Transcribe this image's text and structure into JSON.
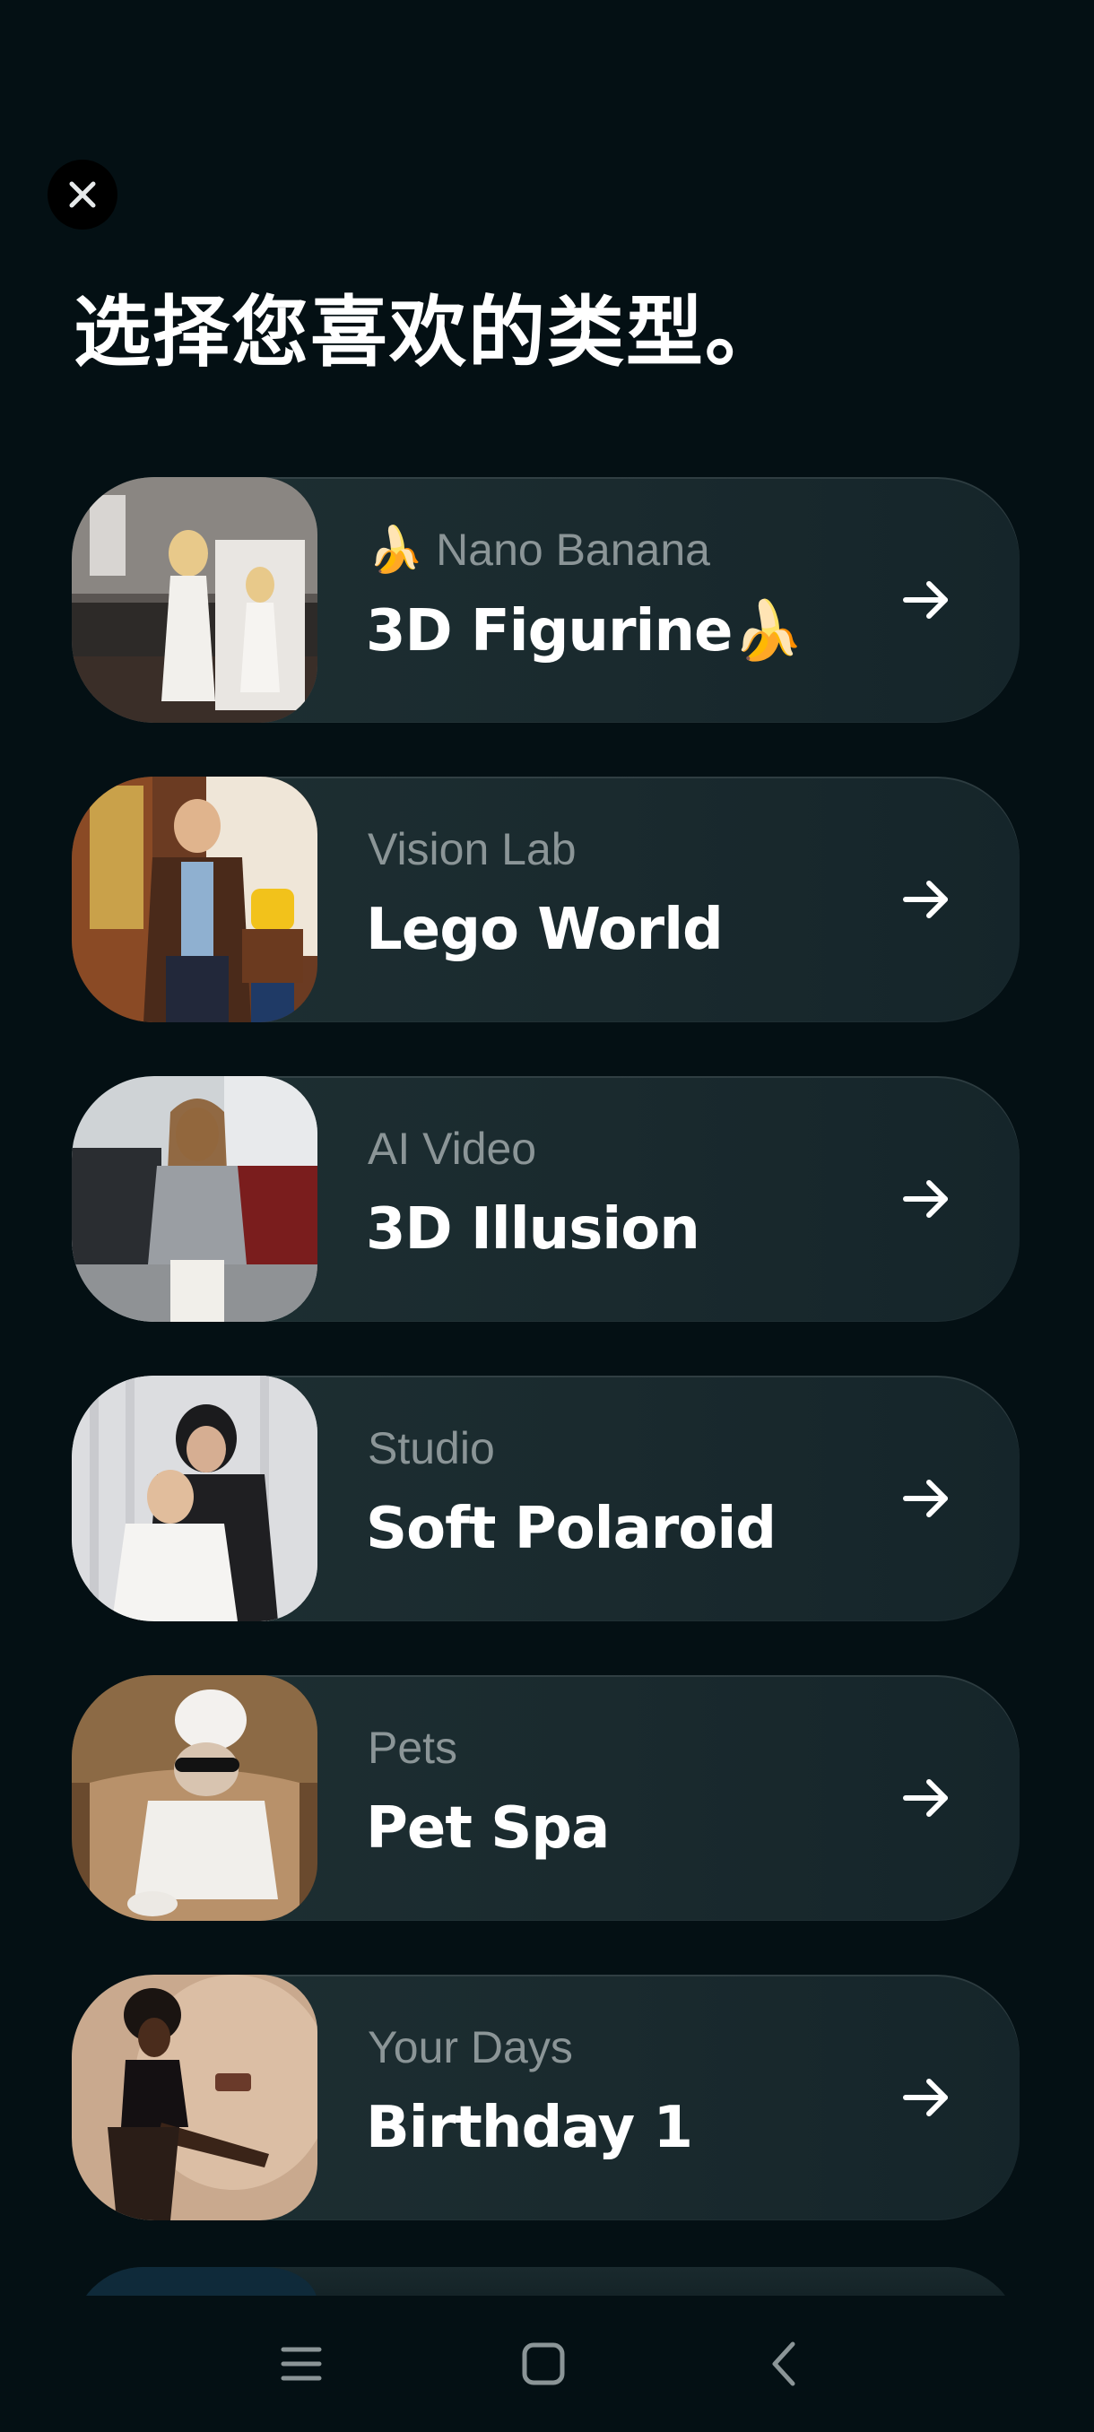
{
  "header": {
    "title": "选择您喜欢的类型。",
    "close_icon": "close-icon"
  },
  "cards": [
    {
      "category": "🍌 Nano Banana",
      "name": "3D Figurine🍌",
      "arrow_icon": "arrow-right-icon"
    },
    {
      "category": "Vision Lab",
      "name": "Lego World",
      "arrow_icon": "arrow-right-icon"
    },
    {
      "category": "AI Video",
      "name": "3D Illusion",
      "arrow_icon": "arrow-right-icon"
    },
    {
      "category": "Studio",
      "name": "Soft Polaroid",
      "arrow_icon": "arrow-right-icon"
    },
    {
      "category": "Pets",
      "name": "Pet Spa",
      "arrow_icon": "arrow-right-icon"
    },
    {
      "category": "Your Days",
      "name": "Birthday 1",
      "arrow_icon": "arrow-right-icon"
    }
  ],
  "system_nav": {
    "items": [
      "menu-icon",
      "home-icon",
      "back-icon"
    ]
  },
  "colors": {
    "background": "#041014",
    "card": "#1b2b2f",
    "category_text": "#8b9597",
    "title_text": "#ffffff"
  }
}
